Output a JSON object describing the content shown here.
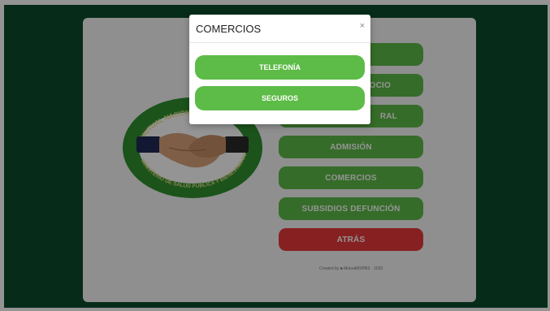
{
  "background": {
    "frame_color": "#0b4d2c",
    "card_color": "#f7f7f7"
  },
  "logo": {
    "icon": "handshake-icon",
    "top_text": "MUTUAL NACIONAL",
    "bottom_text": "MINISTERIO DE SALUD PÚBLICA Y BIENESTAR SOCIAL"
  },
  "menu": {
    "items": [
      {
        "label": "",
        "color": "#5dbb47"
      },
      {
        "label": "OCIO",
        "color": "#5dbb47"
      },
      {
        "label": "RAL",
        "color": "#5dbb47"
      },
      {
        "label": "ADMISIÓN",
        "color": "#5dbb47"
      },
      {
        "label": "COMERCIOS",
        "color": "#5dbb47"
      },
      {
        "label": "SUBSIDIOS DEFUNCIÓN",
        "color": "#5dbb47"
      },
      {
        "label": "ATRÁS",
        "color": "#e83a3a"
      }
    ],
    "footer": "Created by ■ MutualMSPBS · 2020"
  },
  "modal": {
    "title": "COMERCIOS",
    "close_glyph": "×",
    "buttons": [
      {
        "label": "TELEFONÍA"
      },
      {
        "label": "SEGUROS"
      }
    ],
    "button_color": "#5dbb47"
  }
}
